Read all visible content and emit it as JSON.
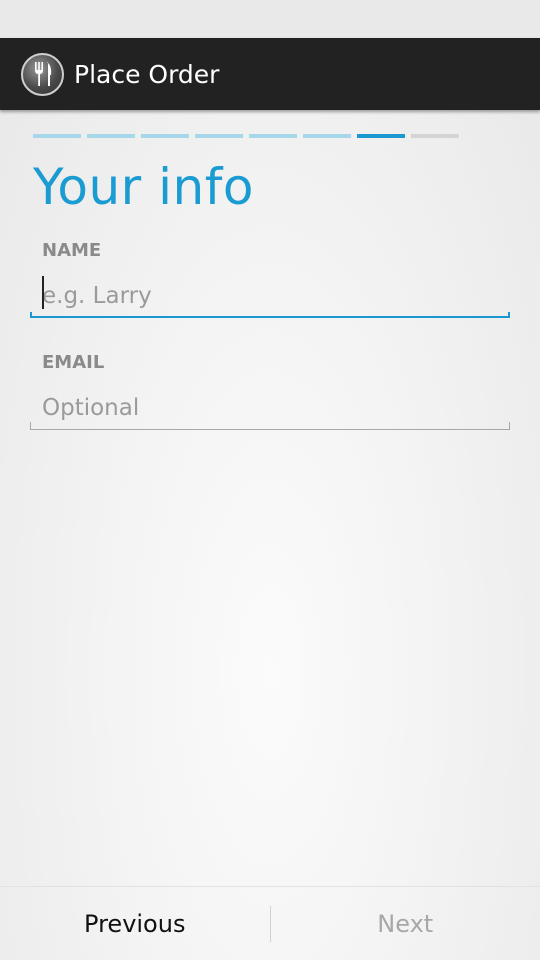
{
  "app": {
    "title": "Place Order",
    "icon": "fork-knife-icon"
  },
  "progress": {
    "total_steps": 8,
    "current_step": 7
  },
  "page": {
    "title": "Your info"
  },
  "form": {
    "name": {
      "label": "NAME",
      "placeholder": "e.g. Larry",
      "value": ""
    },
    "email": {
      "label": "EMAIL",
      "placeholder": "Optional",
      "value": ""
    }
  },
  "nav": {
    "previous_label": "Previous",
    "next_label": "Next",
    "next_enabled": false
  },
  "colors": {
    "accent": "#1b98cf",
    "action_bar": "#222222",
    "step_done": "#a7d8ea",
    "step_pending": "#d4d4d4"
  }
}
